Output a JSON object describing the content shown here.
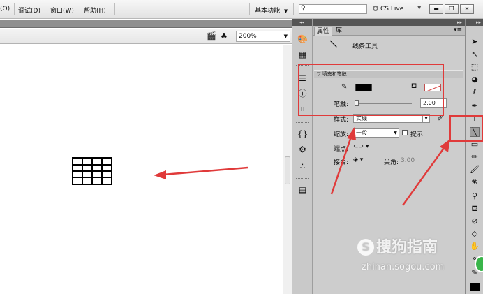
{
  "menu": {
    "items": [
      "(O)",
      "调试(D)",
      "窗口(W)",
      "帮助(H)"
    ],
    "workspace": "基本功能",
    "cs_live": "CS Live",
    "search_icon": "search-icon"
  },
  "stage": {
    "zoom": "200%"
  },
  "properties": {
    "tab_properties": "属性",
    "tab_library": "库",
    "tool_name": "线条工具",
    "section_fill_stroke": "填充和笔触",
    "stroke_label": "笔触:",
    "stroke_width": "2.00",
    "style_label": "样式:",
    "style_value": "实线",
    "scale_label": "缩放:",
    "scale_value": "一般",
    "hint_label": "提示",
    "cap_label": "端点:",
    "join_label": "接合:",
    "miter_label": "尖角:",
    "miter_value": "3.00"
  },
  "colors": {
    "annotation_red": "#e03a3a",
    "stroke_color": "#000000"
  },
  "watermark": {
    "brand": "搜狗指南",
    "url": "zhinan.sogou.com"
  }
}
